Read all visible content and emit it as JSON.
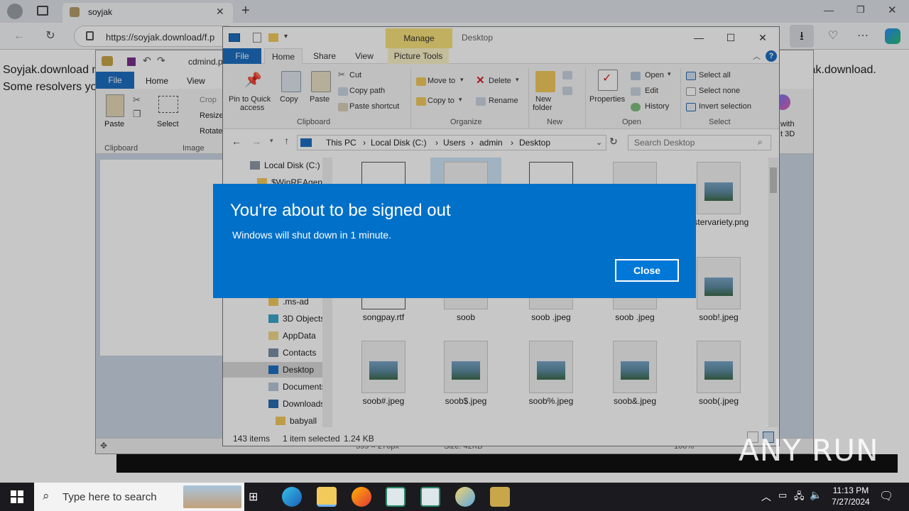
{
  "browser": {
    "tab_title": "soyjak",
    "url": "https://soyjak.download/f.p",
    "new_tab_symbol": "+"
  },
  "webpage": {
    "line1_left": "Soyjak.download m",
    "line2_left": "Some resolvers yo",
    "line1_right": "jak.download."
  },
  "paint": {
    "title": "cdmind.p",
    "tabs": {
      "file": "File",
      "home": "Home",
      "view": "View"
    },
    "ribbon": {
      "paste": "Paste",
      "select": "Select",
      "crop": "Crop",
      "resize": "Resize",
      "rotate": "Rotate",
      "clipboard_group": "Clipboard",
      "image_group": "Image",
      "paint3d_line1": "with",
      "paint3d_line2": "t 3D"
    },
    "status_dims": "599 × 276px",
    "status_size": "Size: 42KB",
    "status_zoom": "100%"
  },
  "explorer": {
    "title": "Desktop",
    "manage_tab": "Manage",
    "tabs": [
      "File",
      "Home",
      "Share",
      "View",
      "Picture Tools"
    ],
    "ribbon": {
      "pin_line1": "Pin to Quick",
      "pin_line2": "access",
      "copy": "Copy",
      "paste": "Paste",
      "cut": "Cut",
      "copy_path": "Copy path",
      "paste_shortcut": "Paste shortcut",
      "move_to": "Move to",
      "copy_to": "Copy to",
      "delete": "Delete",
      "rename": "Rename",
      "new_folder_line1": "New",
      "new_folder_line2": "folder",
      "properties": "Properties",
      "open": "Open",
      "edit": "Edit",
      "history": "History",
      "select_all": "Select all",
      "select_none": "Select none",
      "invert_selection": "Invert selection",
      "groups": [
        "Clipboard",
        "Organize",
        "New",
        "Open",
        "Select"
      ]
    },
    "breadcrumb": [
      "This PC",
      "Local Disk (C:)",
      "Users",
      "admin",
      "Desktop"
    ],
    "search_placeholder": "Search Desktop",
    "nav_items": [
      "Local Disk (C:)",
      "$WinREAgent",
      ".ms-ad",
      "3D Objects",
      "AppData",
      "Contacts",
      "Desktop",
      "Documents",
      "Downloads",
      "babyall"
    ],
    "files": [
      {
        "name": "",
        "kind": "doc"
      },
      {
        "name": "",
        "kind": "blank"
      },
      {
        "name": "",
        "kind": "doc"
      },
      {
        "name": "",
        "kind": "blank"
      },
      {
        "name": "astervariety.png",
        "kind": "image"
      },
      {
        "name": "songpay.rtf",
        "kind": "doc"
      },
      {
        "name": "soob",
        "kind": "blank"
      },
      {
        "name": "soob .jpeg",
        "kind": "blank"
      },
      {
        "name": "soob .jpeg",
        "kind": "blank"
      },
      {
        "name": "soob!.jpeg",
        "kind": "image"
      },
      {
        "name": "soob#.jpeg",
        "kind": "image"
      },
      {
        "name": "soob$.jpeg",
        "kind": "image"
      },
      {
        "name": "soob%.jpeg",
        "kind": "image"
      },
      {
        "name": "soob&.jpeg",
        "kind": "image"
      },
      {
        "name": "soob(.jpeg",
        "kind": "image"
      }
    ],
    "status_items": "143 items",
    "status_selected": "1 item selected",
    "status_size": "1.24 KB"
  },
  "dialog": {
    "title": "You're about to be signed out",
    "message": "Windows will shut down in 1 minute.",
    "close_label": "Close"
  },
  "watermark": "ANY RUN",
  "taskbar": {
    "search_placeholder": "Type here to search",
    "time": "11:13 PM",
    "date": "7/27/2024"
  },
  "colors": {
    "dialog_bg": "#0070c8",
    "taskbar_bg": "#1b1b1f",
    "accent": "#1e6fc0"
  }
}
